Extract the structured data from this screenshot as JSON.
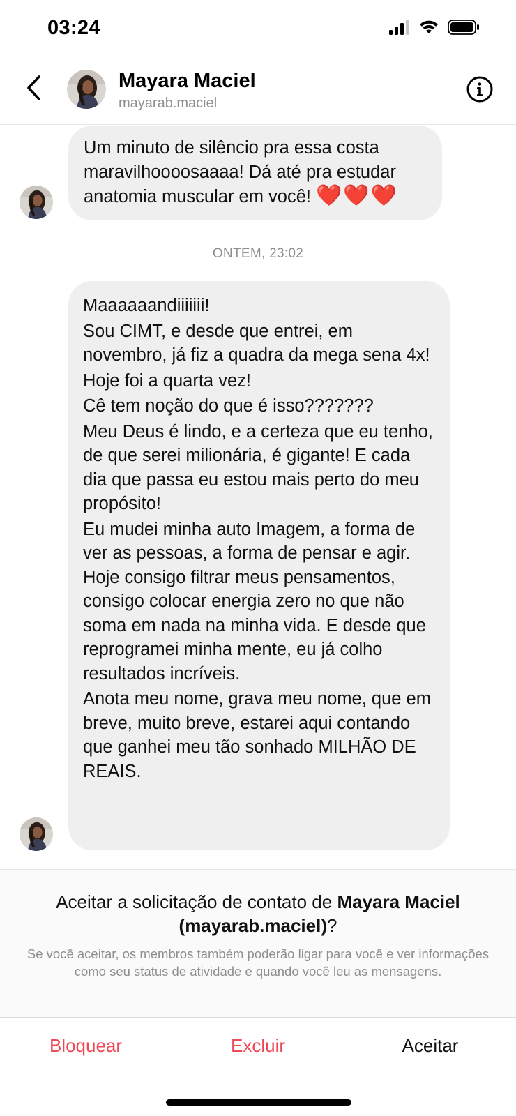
{
  "status_bar": {
    "time": "03:24",
    "icons": [
      "cellular-signal-icon",
      "wifi-icon",
      "battery-icon"
    ]
  },
  "header": {
    "back_icon": "chevron-left-icon",
    "contact_name": "Mayara Maciel",
    "contact_username": "mayarab.maciel",
    "info_icon": "info-circle-icon"
  },
  "messages": {
    "first": {
      "text": "Um minuto de silêncio pra essa costa maravilhoooosaaaa! Dá até pra estudar anatomia muscular em você!",
      "emoji": "❤️❤️❤️"
    },
    "timestamp": "ONTEM, 23:02",
    "second": {
      "paragraphs": [
        "Maaaaaandiiiiiii!",
        "Sou CIMT, e desde que entrei, em novembro, já fiz a quadra da mega sena 4x!",
        "Hoje foi a quarta vez!",
        "Cê tem noção do que é isso???????",
        "Meu Deus é lindo, e a certeza que eu tenho,  de que serei milionária, é gigante! E cada dia que passa eu estou mais perto do meu propósito!",
        "Eu mudei minha auto Imagem, a forma de ver as pessoas, a forma de pensar e agir. Hoje consigo filtrar meus pensamentos, consigo colocar energia zero no que não soma em nada na minha vida. E desde que reprogramei minha mente, eu já colho resultados incríveis.",
        "Anota meu nome, grava meu nome, que em breve, muito breve, estarei aqui contando que ganhei meu tão sonhado MILHÃO DE REAIS."
      ]
    }
  },
  "request": {
    "title_prefix": "Aceitar a solicitação de contato de ",
    "title_name": "Mayara Maciel (mayarab.maciel)",
    "title_suffix": "?",
    "description": "Se você aceitar, os membros também poderão ligar para você e ver informações como seu status de atividade e quando você leu as mensagens."
  },
  "actions": {
    "block": "Bloquear",
    "delete": "Excluir",
    "accept": "Aceitar"
  },
  "colors": {
    "destructive": "#ed4956",
    "bubble": "#efefef",
    "secondary_text": "#8e8e8e"
  }
}
